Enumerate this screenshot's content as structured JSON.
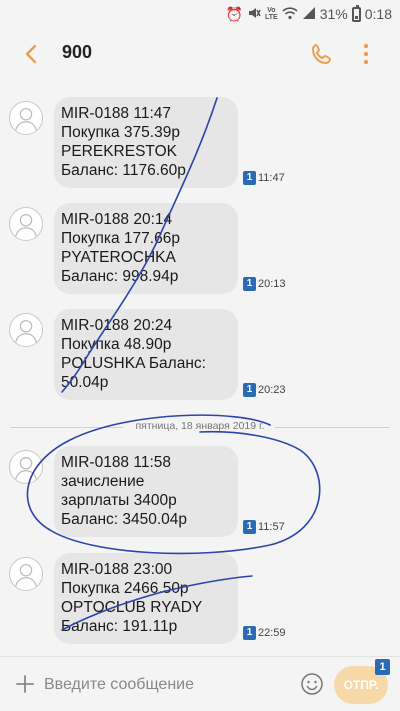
{
  "status_bar": {
    "battery": "31%",
    "time": "0:18",
    "network": "LTE"
  },
  "header": {
    "title": "900"
  },
  "messages": [
    {
      "lines": [
        "MIR-0188 11:47",
        "Покупка 375.39р",
        "PEREKRESTOK",
        "Баланс: 1176.60р"
      ],
      "sim": "1",
      "time": "11:47"
    },
    {
      "lines": [
        "MIR-0188 20:14",
        "Покупка 177.66р",
        "PYATEROCHKA",
        "Баланс: 998.94р"
      ],
      "sim": "1",
      "time": "20:13"
    },
    {
      "lines": [
        "MIR-0188 20:24",
        "Покупка 48.90р",
        "POLUSHKA Баланс:",
        "50.04р"
      ],
      "sim": "1",
      "time": "20:23"
    },
    {
      "lines": [
        "MIR-0188 11:58",
        "зачисление",
        "зарплаты 3400р",
        "Баланс: 3450.04р"
      ],
      "sim": "1",
      "time": "11:57"
    },
    {
      "lines": [
        "MIR-0188 23:00",
        "Покупка 2466.50р",
        "OPTOCLUB RYADY",
        "Баланс: 191.11р"
      ],
      "sim": "1",
      "time": "22:59"
    }
  ],
  "date_separator": "пятница, 18 января 2019 г.",
  "composer": {
    "placeholder": "Введите сообщение",
    "send_label": "ОТПР.",
    "send_sim": "1"
  },
  "colors": {
    "accent": "#e8a050",
    "bubble": "#e6e6e6",
    "sim_badge": "#2b6bb5",
    "scribble": "#2a44a8"
  }
}
